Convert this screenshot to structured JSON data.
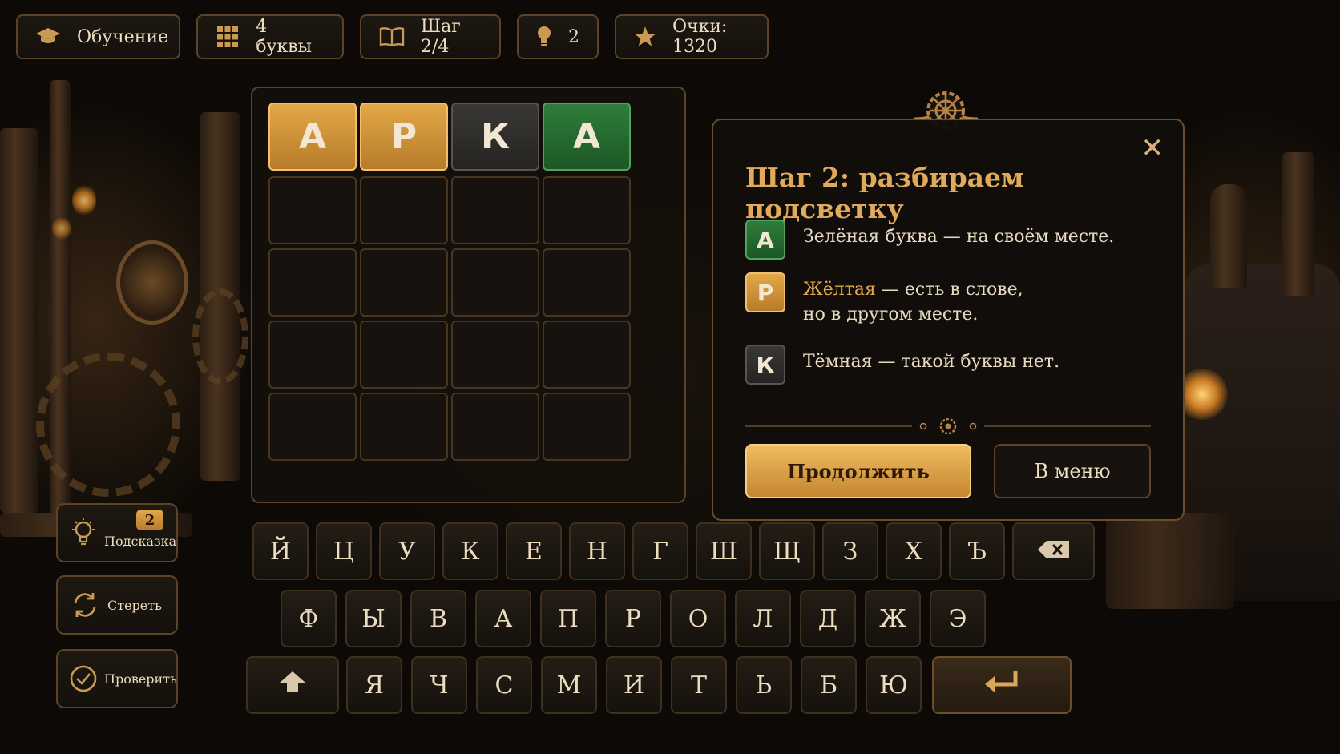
{
  "topbar": {
    "tutorial": {
      "icon": "graduation-cap-icon",
      "label": "Обучение"
    },
    "letters": {
      "icon": "grid-icon",
      "label": "4 буквы"
    },
    "step": {
      "icon": "book-icon",
      "label": "Шаг 2/4"
    },
    "hints": {
      "icon": "lightbulb-icon",
      "label": "2"
    },
    "score": {
      "icon": "star-icon",
      "label": "Очки: 1320"
    }
  },
  "board": {
    "rows": [
      [
        {
          "letter": "А",
          "state": "yellow"
        },
        {
          "letter": "Р",
          "state": "yellow"
        },
        {
          "letter": "К",
          "state": "dark"
        },
        {
          "letter": "А",
          "state": "green"
        }
      ],
      [
        {
          "letter": "",
          "state": "empty"
        },
        {
          "letter": "",
          "state": "empty"
        },
        {
          "letter": "",
          "state": "empty"
        },
        {
          "letter": "",
          "state": "empty"
        }
      ],
      [
        {
          "letter": "",
          "state": "empty"
        },
        {
          "letter": "",
          "state": "empty"
        },
        {
          "letter": "",
          "state": "empty"
        },
        {
          "letter": "",
          "state": "empty"
        }
      ],
      [
        {
          "letter": "",
          "state": "empty"
        },
        {
          "letter": "",
          "state": "empty"
        },
        {
          "letter": "",
          "state": "empty"
        },
        {
          "letter": "",
          "state": "empty"
        }
      ],
      [
        {
          "letter": "",
          "state": "empty"
        },
        {
          "letter": "",
          "state": "empty"
        },
        {
          "letter": "",
          "state": "empty"
        },
        {
          "letter": "",
          "state": "empty"
        }
      ]
    ]
  },
  "dialog": {
    "title": "Шаг 2: разбираем подсветку",
    "green": {
      "letter": "А",
      "text": "Зелёная буква — на своём месте."
    },
    "yellow": {
      "letter": "Р",
      "highlight": "Жёлтая",
      "text1": " — есть в слове,",
      "text2": "но в другом месте."
    },
    "dark": {
      "letter": "К",
      "text": "Тёмная — такой буквы нет."
    },
    "continue_label": "Продолжить",
    "menu_label": "В меню"
  },
  "side": {
    "hint_label": "Подсказка",
    "hint_count": "2",
    "erase_label": "Стереть",
    "check_label": "Проверить"
  },
  "keyboard": {
    "row1": [
      "Й",
      "Ц",
      "У",
      "К",
      "Е",
      "Н",
      "Г",
      "Ш",
      "Щ",
      "З",
      "Х",
      "Ъ"
    ],
    "row2": [
      "Ф",
      "Ы",
      "В",
      "А",
      "П",
      "Р",
      "О",
      "Л",
      "Д",
      "Ж",
      "Э"
    ],
    "row3": [
      "Я",
      "Ч",
      "С",
      "М",
      "И",
      "Т",
      "Ь",
      "Б",
      "Ю"
    ]
  },
  "colors": {
    "green": "#2f7d3a",
    "yellow": "#e3a847",
    "dark": "#3a3835",
    "accent": "#c99a52"
  }
}
